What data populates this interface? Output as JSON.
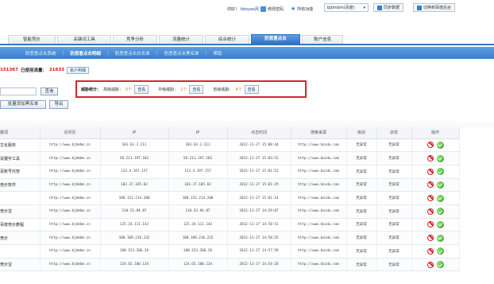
{
  "topbar": {
    "welcome": "你好！",
    "username": "bbsyao风",
    "change_password": "修改密码",
    "all_features": "所有功能",
    "account_select": "bjbmbm(百度)",
    "sync": "同步数据",
    "switch_baidu": "切换到百度后台"
  },
  "main_tabs": [
    {
      "label": "智能竞价"
    },
    {
      "label": "关键词工具"
    },
    {
      "label": "竞争分析"
    },
    {
      "label": "流量统计"
    },
    {
      "label": "综合统计"
    },
    {
      "label": "防恶意点击"
    },
    {
      "label": "账户信息"
    }
  ],
  "sub_tabs": [
    {
      "label": "防恶意点击系统"
    },
    {
      "label": "防恶意点击明细"
    },
    {
      "label": "防恶意点击白名单"
    },
    {
      "label": "防恶意点击黑名单"
    },
    {
      "label": "帮助"
    }
  ],
  "info": {
    "count_a": "151367",
    "used_label": "已使用流量：",
    "count_b": "21633",
    "detail_button": "账户明细"
  },
  "stats": {
    "title": "威胁统计：",
    "high_label": "高级威胁：",
    "high_count": "0个",
    "mid_label": "中级威胁：",
    "mid_count": "1个",
    "low_label": "低级威胁：",
    "low_count": "4个",
    "view": "查看"
  },
  "controls": {
    "query": "查询",
    "batch_blacklist": "批量添加黑名单",
    "export": "导出"
  },
  "table": {
    "headers": [
      "键词",
      "访问页",
      "IP",
      "IP",
      "点击时间",
      "搜索来源",
      "级别",
      "状态",
      "操作"
    ],
    "rows": [
      {
        "kw": "文化服务",
        "page": "http://www.bjbmbm.cn",
        "ip": "183.63.2.211",
        "ip2": "183.63.2.211",
        "time": "2012-11-27 15:08:44",
        "src": "http://www.baidu.com",
        "level": "无异常",
        "status": "无异常"
      },
      {
        "kw": "关键字工具",
        "page": "http://www.bjbmbm.cn",
        "ip": "58.211.197.182",
        "ip2": "58.211.197.182",
        "time": "2012-11-27 15:03:52",
        "src": "http://www.baidu.com",
        "level": "无异常",
        "status": "无异常"
      },
      {
        "kw": "百账号托管",
        "page": "http://www.bjbmbm.cn",
        "ip": "123.4.197.157",
        "ip2": "123.4.197.157",
        "time": "2012-11-27 15:01:52",
        "src": "http://www.baidu.com",
        "level": "无异常",
        "status": "无异常"
      },
      {
        "kw": "竞价软件",
        "page": "http://www.bjbmbm.cn",
        "ip": "183.37.185.83",
        "ip2": "183.37.185.83",
        "time": "2012-11-27 15:01:29",
        "src": "http://www.baidu.com",
        "level": "无异常",
        "status": "无异常"
      },
      {
        "kw": "",
        "page": "http://www.bjbmbm.cn",
        "ip": "180.153.214.200",
        "ip2": "180.153.214.200",
        "time": "2012-11-27 15:01:14",
        "src": "http://www.baidu.com",
        "level": "无异常",
        "status": "无异常"
      },
      {
        "kw": "竞价宝",
        "page": "http://www.bjbmbm.cn",
        "ip": "110.53.94.87",
        "ip2": "110.53.94.87",
        "time": "2012-11-27 14:59:07",
        "src": "http://www.baidu.com",
        "level": "无异常",
        "status": "无异常"
      },
      {
        "kw": "百度竞价教程",
        "page": "http://www.bjbmbm.cn",
        "ip": "125.34.111.142",
        "ip2": "125.34.111.142",
        "time": "2012-11-27 14:58:51",
        "src": "http://www.baidu.com",
        "level": "无异常",
        "status": "无异常"
      },
      {
        "kw": "竞价",
        "page": "http://www.bjbmbm.cn",
        "ip": "180.109.216.232",
        "ip2": "180.109.216.232",
        "time": "2012-11-27 14:58:35",
        "src": "http://www.baidu.com",
        "level": "无异常",
        "status": "无异常"
      },
      {
        "kw": "",
        "page": "http://www.bjbmbm.cn",
        "ip": "180.153.206.26",
        "ip2": "180.153.206.26",
        "time": "2012-11-27 14:57:59",
        "src": "http://www.baidu.com",
        "level": "无异常",
        "status": "无异常"
      },
      {
        "kw": "竞价宝",
        "page": "http://www.bjbmbm.cn",
        "ip": "124.65.100.134",
        "ip2": "124.65.100.134",
        "time": "2012-11-27 14:54:26",
        "src": "http://www.baidu.com",
        "level": "无异常",
        "status": "无异常"
      }
    ]
  }
}
